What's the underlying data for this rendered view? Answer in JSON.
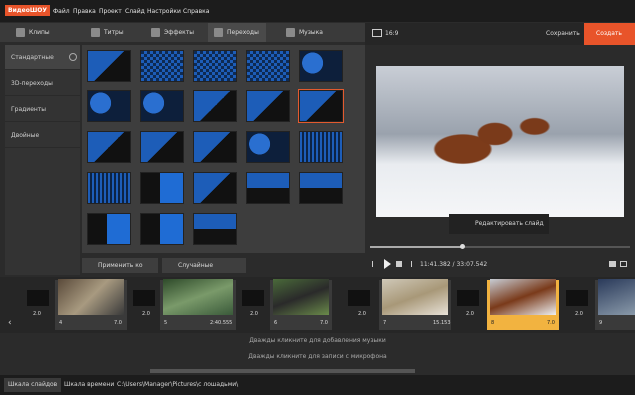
{
  "app": {
    "logo": "ВидеоШОУ"
  },
  "menu": [
    "Файл",
    "Правка",
    "Проект",
    "Слайд",
    "Настройки",
    "Справка"
  ],
  "tabs": [
    "Клипы",
    "Титры",
    "Эффекты",
    "Переходы",
    "Музыка"
  ],
  "categories": [
    "Стандартные",
    "3D-переходы",
    "Градиенты",
    "Двойные"
  ],
  "buttons": {
    "apply_all": "Применить ко всем",
    "random": "Случайные переходы"
  },
  "preview": {
    "ratio": "16:9",
    "save": "Сохранить",
    "create": "Создать",
    "edit_slide": "Редактировать слайд",
    "timecode": "11:41.382 / 33:07.542"
  },
  "timeline": {
    "slides": [
      {
        "num": "4",
        "dur": "7.0"
      },
      {
        "num": "5",
        "dur": "2:40.555"
      },
      {
        "num": "6",
        "dur": "7.0"
      },
      {
        "num": "7",
        "dur": "15.153"
      },
      {
        "num": "8",
        "dur": "7.0"
      },
      {
        "num": "9",
        "dur": ""
      }
    ],
    "transitions": [
      "2.0",
      "2.0",
      "2.0",
      "2.0",
      "2.0",
      "2.0"
    ],
    "music_hint": "Дважды кликните для добавления музыки",
    "mic_hint": "Дважды кликните для записи с микрофона"
  },
  "status": {
    "tab_slides": "Шкала слайдов",
    "tab_time": "Шкала времени",
    "path": "C:\\Users\\Manager\\Pictures\\с лошадьми\\"
  },
  "colors": {
    "accent": "#e8542a",
    "transition_blue": "#1d5db8"
  }
}
